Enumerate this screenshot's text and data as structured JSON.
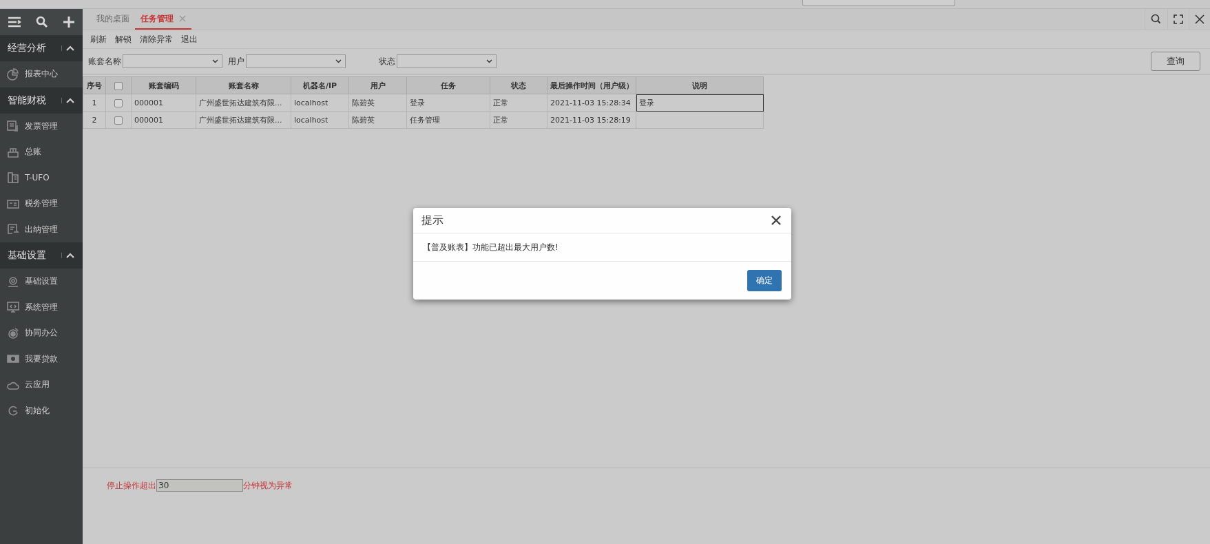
{
  "sidebar": {
    "groups": [
      {
        "title": "经营分析",
        "expanded": true,
        "items": [
          {
            "label": "报表中心"
          }
        ]
      },
      {
        "title": "智能财税",
        "expanded": true,
        "items": [
          {
            "label": "发票管理"
          },
          {
            "label": "总账"
          },
          {
            "label": "T-UFO"
          },
          {
            "label": "税务管理"
          },
          {
            "label": "出纳管理"
          }
        ]
      },
      {
        "title": "基础设置",
        "expanded": true,
        "items": [
          {
            "label": "基础设置"
          },
          {
            "label": "系统管理"
          },
          {
            "label": "协同办公"
          },
          {
            "label": "我要贷款"
          },
          {
            "label": "云应用"
          },
          {
            "label": "初始化"
          }
        ]
      }
    ]
  },
  "tabs": [
    {
      "label": "我的桌面",
      "selected": false,
      "closable": false
    },
    {
      "label": "任务管理",
      "selected": true,
      "closable": true
    }
  ],
  "toolbar": [
    "刷新",
    "解锁",
    "清除异常",
    "退出"
  ],
  "filters": [
    {
      "label": "账套名称"
    },
    {
      "label": "用户"
    },
    {
      "label": "状态"
    }
  ],
  "query_button": "查询",
  "table": {
    "columns": [
      "序号",
      "账套编码",
      "账套名称",
      "机器名/IP",
      "用户",
      "任务",
      "状态",
      "最后操作时间（用户级）",
      "说明"
    ],
    "header_checked": false,
    "rows": [
      {
        "checked": false,
        "editing": true,
        "cells": [
          "1",
          "000001",
          "广州盛世拓达建筑有限...",
          "localhost",
          "陈碧英",
          "登录",
          "正常",
          "2021-11-03 15:28:34",
          "登录"
        ]
      },
      {
        "checked": false,
        "editing": false,
        "cells": [
          "2",
          "000001",
          "广州盛世拓达建筑有限...",
          "localhost",
          "陈碧英",
          "任务管理",
          "正常",
          "2021-11-03 15:28:19",
          ""
        ]
      }
    ]
  },
  "timeout": {
    "label_before": "停止操作超出",
    "value": "30",
    "label_after": "分钟视为异常"
  },
  "dialog": {
    "title": "提示",
    "message": "【普及账表】功能已超出最大用户数!",
    "button": "确定"
  }
}
